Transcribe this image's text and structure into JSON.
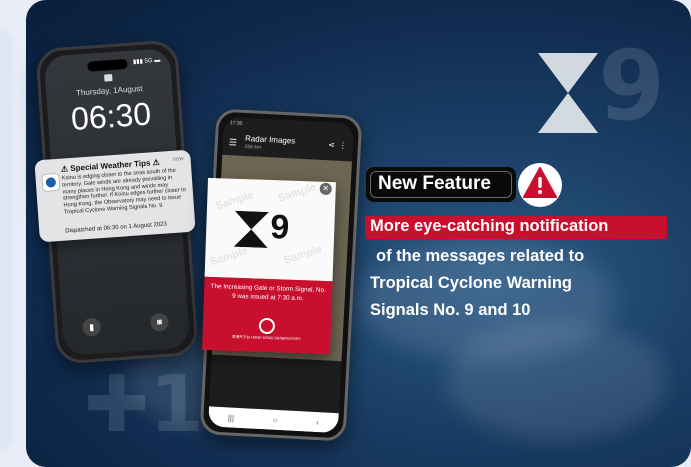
{
  "background": {
    "signal_9": "9",
    "signal_10": "10"
  },
  "phone1": {
    "date": "Thursday, 1August",
    "time": "06:30",
    "notification": {
      "title": "Special Weather Tips",
      "time": "now",
      "body": "Koinu is edging closer to the seas south of the territory. Gale winds are already prevailing in many places in Hong Kong and winds may strengthen further. If Koinu edges further closer to Hong Kong, the Observatory may need to issue Tropical Cyclone Warning Signals No. 9.",
      "dispatch": "Dispatched at 06:30 on 1 August 2023"
    }
  },
  "phone2": {
    "status_time": "17:30",
    "title": "Radar Images",
    "subtitle": "256 km"
  },
  "popup": {
    "signal": "9",
    "watermark": "Sample",
    "message": "The Increasing Gale or Storm Signal, No. 9 was issued at 7:30 a.m.",
    "logo_text": "香港天文台 HONG KONG OBSERVATORY"
  },
  "feature": {
    "badge": "New Feature",
    "highlight": "More eye-catching notification",
    "lines": [
      "of the messages related to",
      "Tropical Cyclone Warning",
      "Signals No. 9 and 10"
    ]
  },
  "colors": {
    "accent_red": "#c8102e",
    "navy": "#0f2a4d"
  }
}
